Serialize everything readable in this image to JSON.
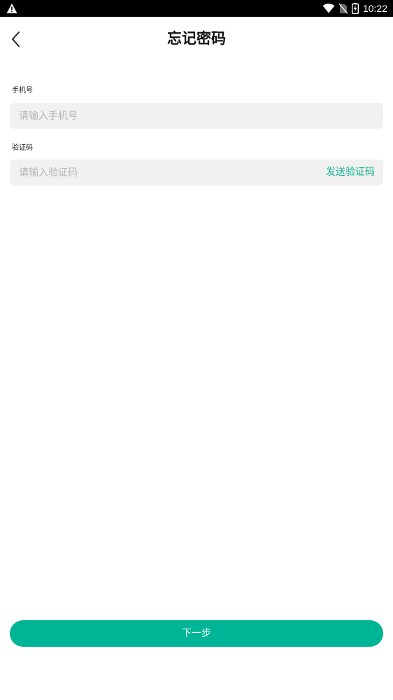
{
  "status_bar": {
    "time": "10:22",
    "icons": [
      "warning-icon",
      "wifi-icon",
      "no-sim-icon",
      "battery-charging-icon"
    ]
  },
  "header": {
    "title": "忘记密码",
    "back_icon": "chevron-left-icon"
  },
  "form": {
    "phone": {
      "label": "手机号",
      "placeholder": "请输入手机号",
      "value": ""
    },
    "code": {
      "label": "验证码",
      "placeholder": "请输入验证码",
      "value": "",
      "send_label": "发送验证码"
    }
  },
  "actions": {
    "next_label": "下一步"
  },
  "colors": {
    "accent": "#00b596",
    "field_bg": "#f1f1f1",
    "placeholder": "#b5b5b5",
    "status_bar_bg": "#000000"
  }
}
